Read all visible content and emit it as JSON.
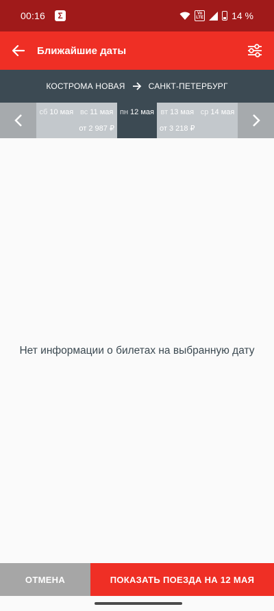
{
  "status_bar": {
    "time": "00:16",
    "volte": "Vo LTE",
    "battery": "14 %"
  },
  "app_bar": {
    "title": "Ближайшие даты"
  },
  "route": {
    "from": "КОСТРОМА НОВАЯ",
    "to": "САНКТ-ПЕТЕРБУРГ"
  },
  "days": [
    {
      "weekday": "сб",
      "date": "10 мая",
      "price": ""
    },
    {
      "weekday": "вс",
      "date": "11 мая",
      "price": "от 2 987 ₽"
    },
    {
      "weekday": "пн",
      "date": "12 мая",
      "price": ""
    },
    {
      "weekday": "вт",
      "date": "13 мая",
      "price": "от 3 218 ₽"
    },
    {
      "weekday": "ср",
      "date": "14 мая",
      "price": ""
    }
  ],
  "message": "Нет информации о билетах на выбранную дату",
  "buttons": {
    "cancel": "ОТМЕНА",
    "show": "ПОКАЗАТЬ ПОЕЗДА НА 12 МАЯ"
  },
  "colors": {
    "status_bar": "#a01a1a",
    "accent": "#ef2f25",
    "route_bar": "#3c4a53",
    "inactive": "#a6a6a6"
  }
}
